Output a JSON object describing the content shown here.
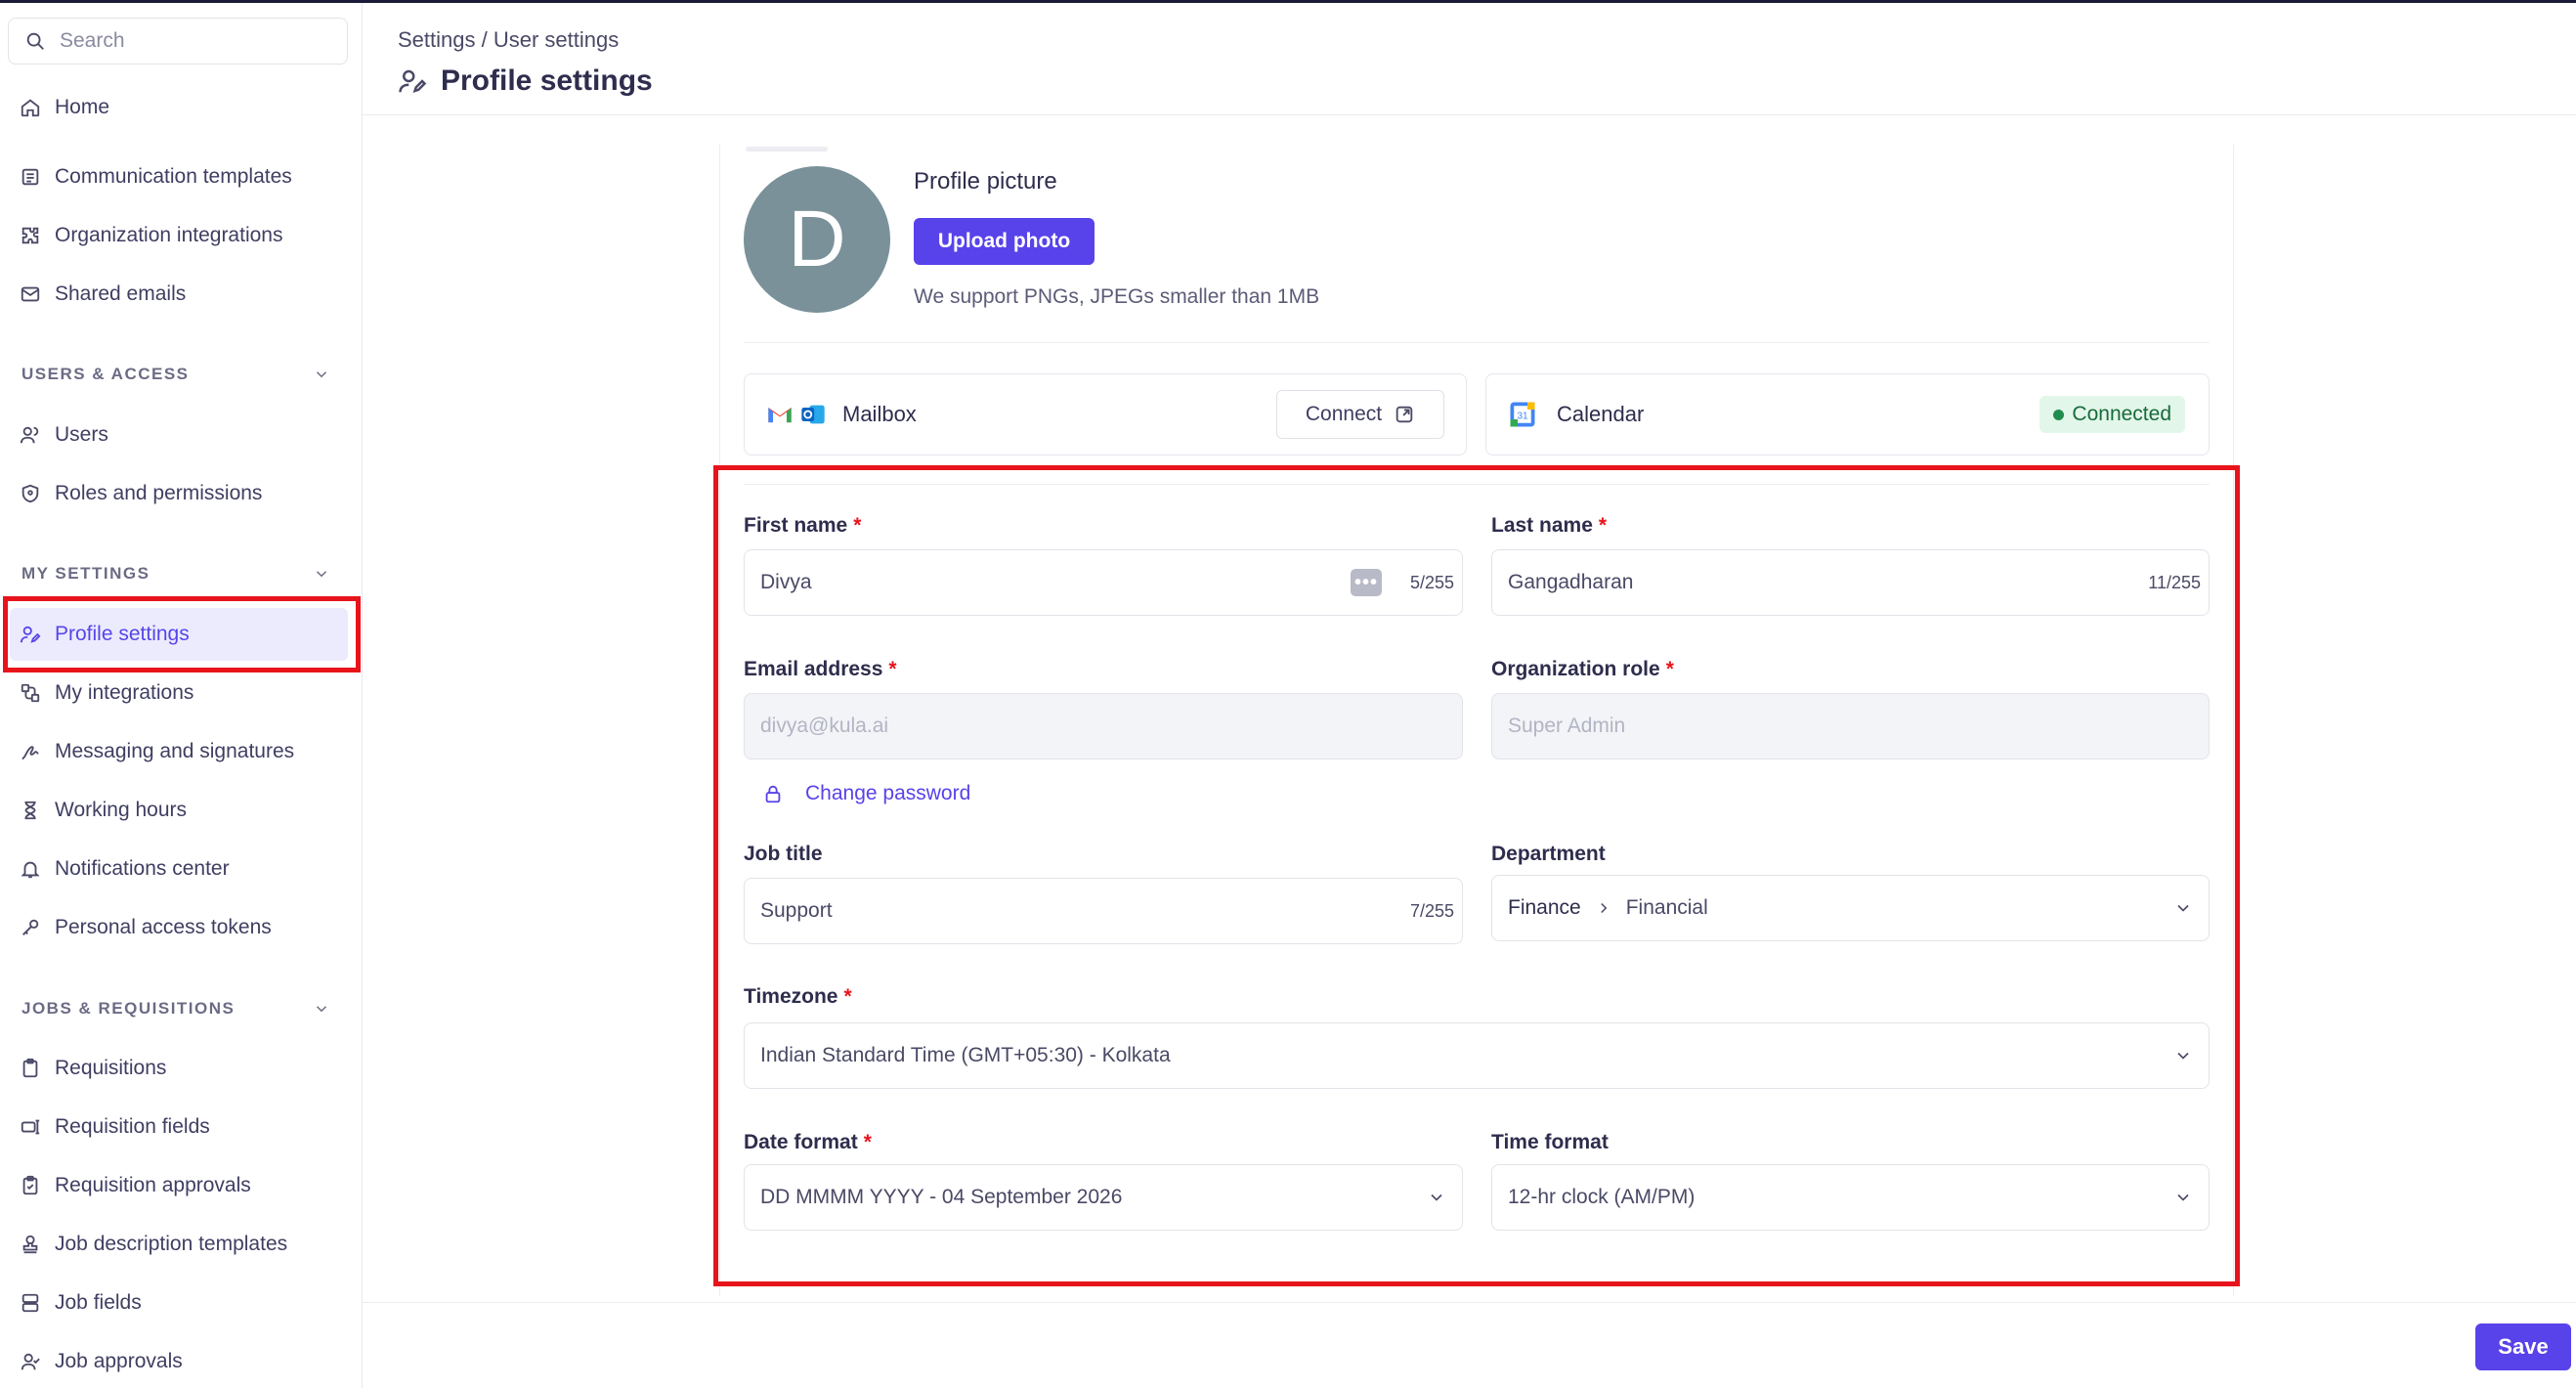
{
  "sidebar": {
    "search_placeholder": "Search",
    "home": "Home",
    "org_items": [
      "Communication templates",
      "Organization integrations",
      "Shared emails"
    ],
    "users_access": {
      "title": "USERS & ACCESS",
      "items": [
        "Users",
        "Roles and permissions"
      ]
    },
    "my_settings": {
      "title": "MY SETTINGS",
      "items": [
        "Profile settings",
        "My integrations",
        "Messaging and signatures",
        "Working hours",
        "Notifications center",
        "Personal access tokens"
      ]
    },
    "jobs": {
      "title": "JOBS & REQUISITIONS",
      "items": [
        "Requisitions",
        "Requisition fields",
        "Requisition approvals",
        "Job description templates",
        "Job fields",
        "Job approvals"
      ]
    }
  },
  "header": {
    "breadcrumb": "Settings / User settings",
    "title": "Profile settings"
  },
  "profile_picture": {
    "initial": "D",
    "title": "Profile picture",
    "upload_label": "Upload photo",
    "hint": "We support PNGs, JPEGs smaller than 1MB"
  },
  "integrations": {
    "mailbox": {
      "label": "Mailbox",
      "action": "Connect"
    },
    "calendar": {
      "label": "Calendar",
      "status": "Connected",
      "icon_text": "31"
    }
  },
  "form": {
    "first_name": {
      "label": "First name",
      "value": "Divya",
      "count": "5/255"
    },
    "last_name": {
      "label": "Last name",
      "value": "Gangadharan",
      "count": "11/255"
    },
    "email": {
      "label": "Email address",
      "value": "divya@kula.ai"
    },
    "org_role": {
      "label": "Organization role",
      "value": "Super Admin"
    },
    "change_password": "Change password",
    "job_title": {
      "label": "Job title",
      "value": "Support",
      "count": "7/255"
    },
    "department": {
      "label": "Department",
      "parent": "Finance",
      "child": "Financial"
    },
    "timezone": {
      "label": "Timezone",
      "value": "Indian Standard Time (GMT+05:30) - Kolkata"
    },
    "date_format": {
      "label": "Date format",
      "value": "DD MMMM YYYY - 04 September 2026"
    },
    "time_format": {
      "label": "Time format",
      "value": "12-hr clock (AM/PM)"
    },
    "required_mark": "*",
    "dots": "•••"
  },
  "footer": {
    "save_label": "Save"
  },
  "colors": {
    "accent": "#5842ea",
    "highlight": "#e8141c",
    "connected": "#1f8d4d"
  }
}
